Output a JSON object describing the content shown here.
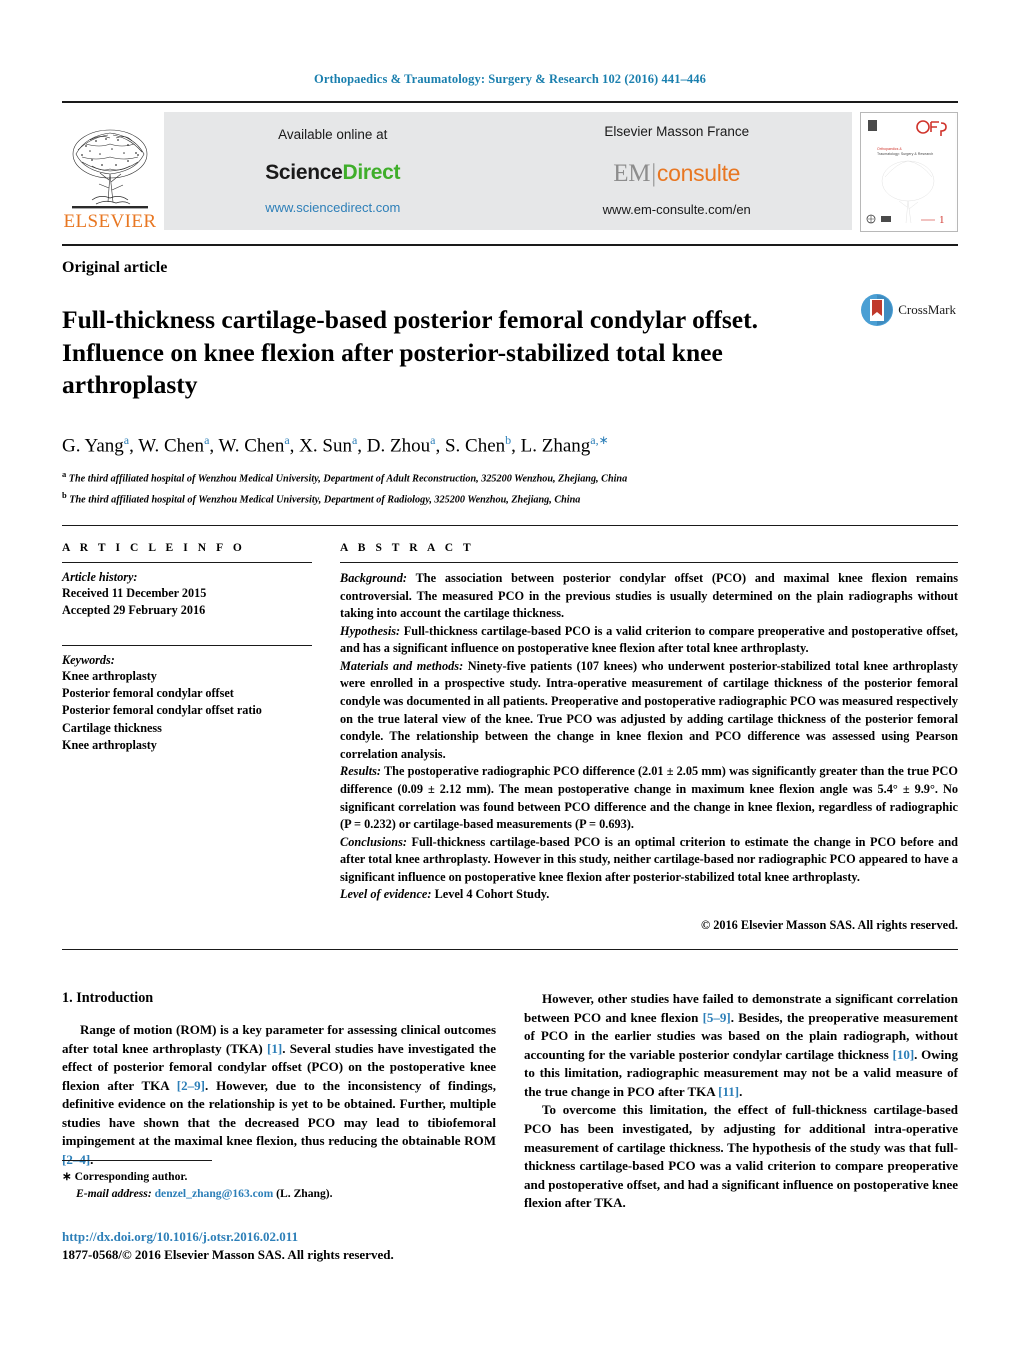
{
  "running_head": "Orthopaedics & Traumatology: Surgery & Research 102 (2016) 441–446",
  "masthead": {
    "publisher_name": "ELSEVIER",
    "available_online_at": "Available online at",
    "sciencedirect_science": "Science",
    "sciencedirect_direct": "Direct",
    "sciencedirect_url": "www.sciencedirect.com",
    "masson_title": "Elsevier Masson France",
    "em_prefix": "EM",
    "em_suffix": "consulte",
    "em_url": "www.em-consulte.com/en",
    "cover_logo_text": "OTSR",
    "cover_journal_line1": "Orthopaedics &",
    "cover_journal_line2": "Traumatology: Surgery & Research",
    "cover_issue_number": "1"
  },
  "article": {
    "type": "Original article",
    "title": "Full-thickness cartilage-based posterior femoral condylar offset. Influence on knee flexion after posterior-stabilized total knee arthroplasty",
    "crossmark_label": "CrossMark",
    "authors_html": "G. Yang<sup>a</sup>, W. Chen<sup>a</sup>, W. Chen<sup>a</sup>, X. Sun<sup>a</sup>, D. Zhou<sup>a</sup>, S. Chen<sup>b</sup>, L. Zhang<sup>a,∗</sup>",
    "affiliation_a": "The third affiliated hospital of Wenzhou Medical University, Department of Adult Reconstruction, 325200 Wenzhou, Zhejiang, China",
    "affiliation_b": "The third affiliated hospital of Wenzhou Medical University, Department of Radiology, 325200 Wenzhou, Zhejiang, China"
  },
  "info": {
    "heading": "A R T I C L E   I N F O",
    "history_label": "Article history:",
    "received": "Received 11 December 2015",
    "accepted": "Accepted 29 February 2016",
    "keywords_label": "Keywords:",
    "keywords": [
      "Knee arthroplasty",
      "Posterior femoral condylar offset",
      "Posterior femoral condylar offset ratio",
      "Cartilage thickness",
      "Knee arthroplasty"
    ]
  },
  "abstract": {
    "heading": "A B S T R A C T",
    "sections": [
      {
        "label": "Background:",
        "text": "The association between posterior condylar offset (PCO) and maximal knee flexion remains controversial. The measured PCO in the previous studies is usually determined on the plain radiographs without taking into account the cartilage thickness."
      },
      {
        "label": "Hypothesis:",
        "text": "Full-thickness cartilage-based PCO is a valid criterion to compare preoperative and postoperative offset, and has a significant influence on postoperative knee flexion after total knee arthroplasty."
      },
      {
        "label": "Materials and methods:",
        "text": "Ninety-five patients (107 knees) who underwent posterior-stabilized total knee arthroplasty were enrolled in a prospective study. Intra-operative measurement of cartilage thickness of the posterior femoral condyle was documented in all patients. Preoperative and postoperative radiographic PCO was measured respectively on the true lateral view of the knee. True PCO was adjusted by adding cartilage thickness of the posterior femoral condyle. The relationship between the change in knee flexion and PCO difference was assessed using Pearson correlation analysis."
      },
      {
        "label": "Results:",
        "text": "The postoperative radiographic PCO difference (2.01 ± 2.05 mm) was significantly greater than the true PCO difference (0.09 ± 2.12 mm). The mean postoperative change in maximum knee flexion angle was 5.4° ± 9.9°. No significant correlation was found between PCO difference and the change in knee flexion, regardless of radiographic (P = 0.232) or cartilage-based measurements (P = 0.693)."
      },
      {
        "label": "Conclusions:",
        "text": "Full-thickness cartilage-based PCO is an optimal criterion to estimate the change in PCO before and after total knee arthroplasty. However in this study, neither cartilage-based nor radiographic PCO appeared to have a significant influence on postoperative knee flexion after posterior-stabilized total knee arthroplasty."
      },
      {
        "label": "Level of evidence:",
        "text": "Level 4 Cohort Study."
      }
    ],
    "copyright": "© 2016 Elsevier Masson SAS. All rights reserved."
  },
  "body": {
    "section_heading": "1.  Introduction",
    "left_paragraphs": [
      "Range of motion (ROM) is a key parameter for assessing clinical outcomes after total knee arthroplasty (TKA) [1]. Several studies have investigated the effect of posterior femoral condylar offset (PCO) on the postoperative knee flexion after TKA [2–9]. However, due to the inconsistency of findings, definitive evidence on the relationship is yet to be obtained. Further, multiple studies have shown that the decreased PCO may lead to tibiofemoral impingement at the maximal knee flexion, thus reducing the obtainable ROM [2–4]."
    ],
    "right_paragraphs": [
      "However, other studies have failed to demonstrate a significant correlation between PCO and knee flexion [5–9]. Besides, the preoperative measurement of PCO in the earlier studies was based on the plain radiograph, without accounting for the variable posterior condylar cartilage thickness [10]. Owing to this limitation, radiographic measurement may not be a valid measure of the true change in PCO after TKA [11].",
      "To overcome this limitation, the effect of full-thickness cartilage-based PCO has been investigated, by adjusting for additional intra-operative measurement of cartilage thickness. The hypothesis of the study was that full-thickness cartilage-based PCO was a valid criterion to compare preoperative and postoperative offset, and had a significant influence on postoperative knee flexion after TKA."
    ],
    "references_inline": [
      "[1]",
      "[2–9]",
      "[2–4]",
      "[5–9]",
      "[10]",
      "[11]"
    ]
  },
  "footnote": {
    "corresponding_marker": "∗",
    "corresponding_text": "Corresponding author.",
    "email_label": "E-mail address:",
    "email": "denzel_zhang@163.com",
    "email_owner": "(L. Zhang)."
  },
  "footer": {
    "doi": "http://dx.doi.org/10.1016/j.otsr.2016.02.011",
    "issn_line": "1877-0568/© 2016 Elsevier Masson SAS. All rights reserved."
  },
  "colors": {
    "link_blue": "#2d7fb8",
    "header_blue": "#1a7fae",
    "elsevier_orange": "#e87722",
    "sciencedirect_green": "#3fae2a",
    "banner_grey": "#e6e7e8"
  }
}
